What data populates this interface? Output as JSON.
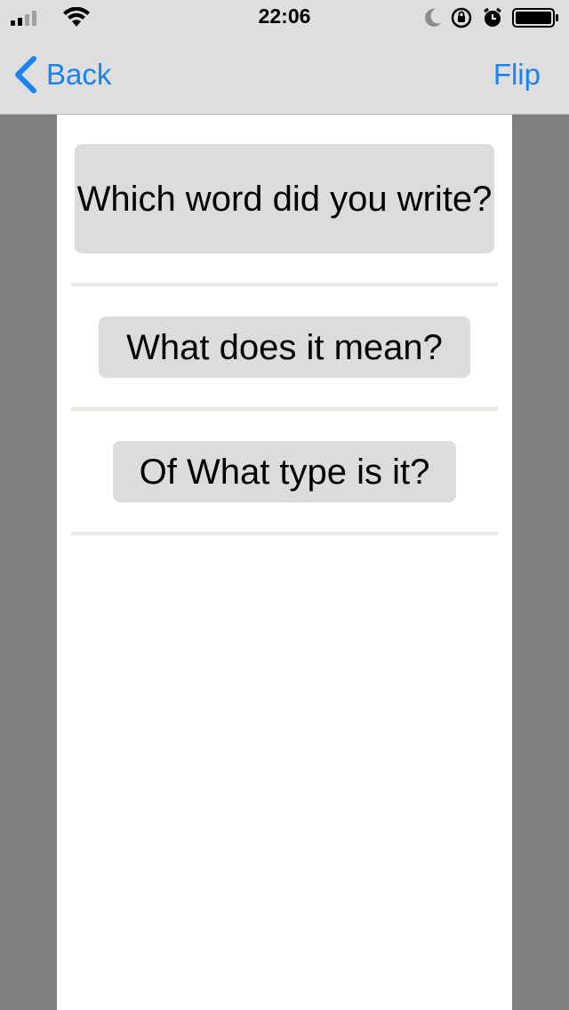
{
  "status_bar": {
    "time": "22:06",
    "icons": [
      "cellular-signal-icon",
      "wifi-icon",
      "moon-icon",
      "orientation-lock-icon",
      "alarm-icon",
      "battery-icon"
    ]
  },
  "nav": {
    "back_label": "Back",
    "flip_label": "Flip",
    "accent_color": "#1a83f0"
  },
  "questions": [
    {
      "text": "Which word did you write?"
    },
    {
      "text": "What does it mean?"
    },
    {
      "text": "Of What type is it?"
    }
  ]
}
